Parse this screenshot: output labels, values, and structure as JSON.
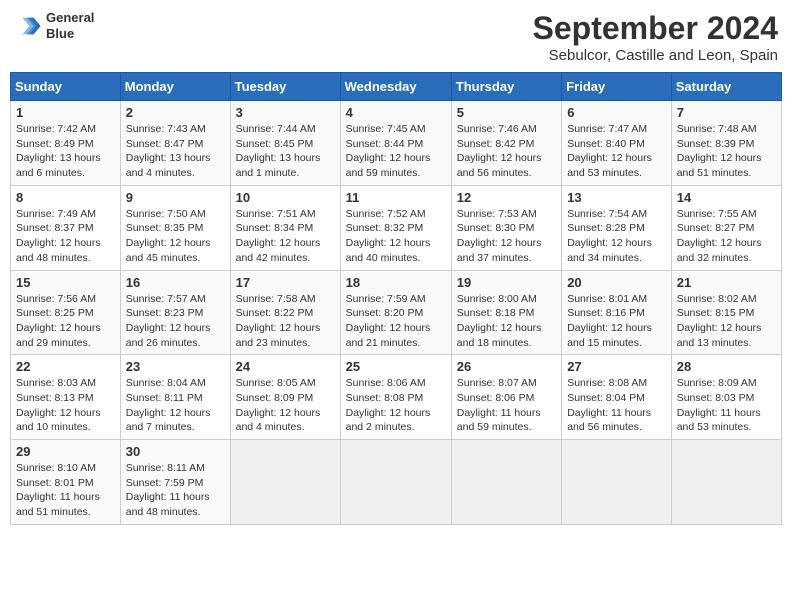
{
  "header": {
    "logo_line1": "General",
    "logo_line2": "Blue",
    "title": "September 2024",
    "subtitle": "Sebulcor, Castille and Leon, Spain"
  },
  "weekdays": [
    "Sunday",
    "Monday",
    "Tuesday",
    "Wednesday",
    "Thursday",
    "Friday",
    "Saturday"
  ],
  "weeks": [
    [
      {
        "day": "1",
        "info": "Sunrise: 7:42 AM\nSunset: 8:49 PM\nDaylight: 13 hours and 6 minutes."
      },
      {
        "day": "2",
        "info": "Sunrise: 7:43 AM\nSunset: 8:47 PM\nDaylight: 13 hours and 4 minutes."
      },
      {
        "day": "3",
        "info": "Sunrise: 7:44 AM\nSunset: 8:45 PM\nDaylight: 13 hours and 1 minute."
      },
      {
        "day": "4",
        "info": "Sunrise: 7:45 AM\nSunset: 8:44 PM\nDaylight: 12 hours and 59 minutes."
      },
      {
        "day": "5",
        "info": "Sunrise: 7:46 AM\nSunset: 8:42 PM\nDaylight: 12 hours and 56 minutes."
      },
      {
        "day": "6",
        "info": "Sunrise: 7:47 AM\nSunset: 8:40 PM\nDaylight: 12 hours and 53 minutes."
      },
      {
        "day": "7",
        "info": "Sunrise: 7:48 AM\nSunset: 8:39 PM\nDaylight: 12 hours and 51 minutes."
      }
    ],
    [
      {
        "day": "8",
        "info": "Sunrise: 7:49 AM\nSunset: 8:37 PM\nDaylight: 12 hours and 48 minutes."
      },
      {
        "day": "9",
        "info": "Sunrise: 7:50 AM\nSunset: 8:35 PM\nDaylight: 12 hours and 45 minutes."
      },
      {
        "day": "10",
        "info": "Sunrise: 7:51 AM\nSunset: 8:34 PM\nDaylight: 12 hours and 42 minutes."
      },
      {
        "day": "11",
        "info": "Sunrise: 7:52 AM\nSunset: 8:32 PM\nDaylight: 12 hours and 40 minutes."
      },
      {
        "day": "12",
        "info": "Sunrise: 7:53 AM\nSunset: 8:30 PM\nDaylight: 12 hours and 37 minutes."
      },
      {
        "day": "13",
        "info": "Sunrise: 7:54 AM\nSunset: 8:28 PM\nDaylight: 12 hours and 34 minutes."
      },
      {
        "day": "14",
        "info": "Sunrise: 7:55 AM\nSunset: 8:27 PM\nDaylight: 12 hours and 32 minutes."
      }
    ],
    [
      {
        "day": "15",
        "info": "Sunrise: 7:56 AM\nSunset: 8:25 PM\nDaylight: 12 hours and 29 minutes."
      },
      {
        "day": "16",
        "info": "Sunrise: 7:57 AM\nSunset: 8:23 PM\nDaylight: 12 hours and 26 minutes."
      },
      {
        "day": "17",
        "info": "Sunrise: 7:58 AM\nSunset: 8:22 PM\nDaylight: 12 hours and 23 minutes."
      },
      {
        "day": "18",
        "info": "Sunrise: 7:59 AM\nSunset: 8:20 PM\nDaylight: 12 hours and 21 minutes."
      },
      {
        "day": "19",
        "info": "Sunrise: 8:00 AM\nSunset: 8:18 PM\nDaylight: 12 hours and 18 minutes."
      },
      {
        "day": "20",
        "info": "Sunrise: 8:01 AM\nSunset: 8:16 PM\nDaylight: 12 hours and 15 minutes."
      },
      {
        "day": "21",
        "info": "Sunrise: 8:02 AM\nSunset: 8:15 PM\nDaylight: 12 hours and 13 minutes."
      }
    ],
    [
      {
        "day": "22",
        "info": "Sunrise: 8:03 AM\nSunset: 8:13 PM\nDaylight: 12 hours and 10 minutes."
      },
      {
        "day": "23",
        "info": "Sunrise: 8:04 AM\nSunset: 8:11 PM\nDaylight: 12 hours and 7 minutes."
      },
      {
        "day": "24",
        "info": "Sunrise: 8:05 AM\nSunset: 8:09 PM\nDaylight: 12 hours and 4 minutes."
      },
      {
        "day": "25",
        "info": "Sunrise: 8:06 AM\nSunset: 8:08 PM\nDaylight: 12 hours and 2 minutes."
      },
      {
        "day": "26",
        "info": "Sunrise: 8:07 AM\nSunset: 8:06 PM\nDaylight: 11 hours and 59 minutes."
      },
      {
        "day": "27",
        "info": "Sunrise: 8:08 AM\nSunset: 8:04 PM\nDaylight: 11 hours and 56 minutes."
      },
      {
        "day": "28",
        "info": "Sunrise: 8:09 AM\nSunset: 8:03 PM\nDaylight: 11 hours and 53 minutes."
      }
    ],
    [
      {
        "day": "29",
        "info": "Sunrise: 8:10 AM\nSunset: 8:01 PM\nDaylight: 11 hours and 51 minutes."
      },
      {
        "day": "30",
        "info": "Sunrise: 8:11 AM\nSunset: 7:59 PM\nDaylight: 11 hours and 48 minutes."
      },
      {
        "day": "",
        "info": ""
      },
      {
        "day": "",
        "info": ""
      },
      {
        "day": "",
        "info": ""
      },
      {
        "day": "",
        "info": ""
      },
      {
        "day": "",
        "info": ""
      }
    ]
  ]
}
